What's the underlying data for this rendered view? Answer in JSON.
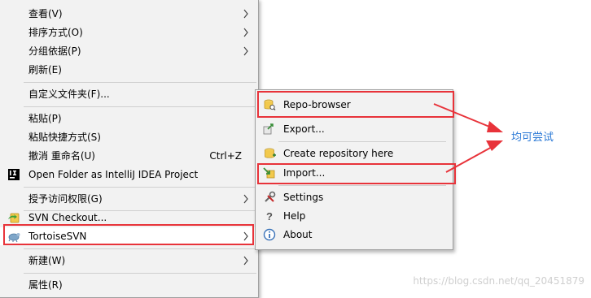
{
  "context_menu": {
    "items": [
      {
        "label": "查看(V)",
        "submenu": true
      },
      {
        "label": "排序方式(O)",
        "submenu": true
      },
      {
        "label": "分组依据(P)",
        "submenu": true
      },
      {
        "label": "刷新(E)"
      },
      {
        "label": "自定义文件夹(F)..."
      },
      {
        "label": "粘贴(P)"
      },
      {
        "label": "粘贴快捷方式(S)"
      },
      {
        "label": "撤消 重命名(U)",
        "shortcut": "Ctrl+Z"
      },
      {
        "label": "Open Folder as IntelliJ IDEA Project",
        "icon": "intellij-idea-icon"
      },
      {
        "label": "授予访问权限(G)",
        "submenu": true
      },
      {
        "label": "SVN Checkout...",
        "icon": "svn-checkout-icon"
      },
      {
        "label": "TortoiseSVN",
        "submenu": true,
        "icon": "tortoisesvn-icon"
      },
      {
        "label": "新建(W)",
        "submenu": true
      },
      {
        "label": "属性(R)"
      }
    ]
  },
  "submenu": {
    "items": [
      {
        "label": "Repo-browser",
        "icon": "repo-browser-icon"
      },
      {
        "label": "Export...",
        "icon": "export-icon"
      },
      {
        "label": "Create repository here",
        "icon": "create-repository-icon"
      },
      {
        "label": "Import...",
        "icon": "import-icon"
      },
      {
        "label": "Settings",
        "icon": "settings-icon"
      },
      {
        "label": "Help",
        "icon": "help-icon"
      },
      {
        "label": "About",
        "icon": "about-icon"
      }
    ]
  },
  "annotation": {
    "text": "均可尝试",
    "color": "#2b79d6"
  },
  "watermark": "https://blog.csdn.net/qq_20451879",
  "colors": {
    "highlight": "#e8333a",
    "menu_bg": "#f2f2f2"
  }
}
